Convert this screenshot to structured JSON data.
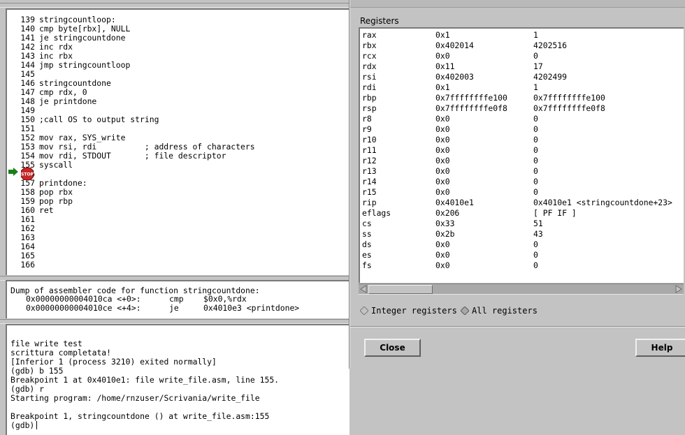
{
  "source": {
    "lines": [
      {
        "num": "139",
        "code": "stringcountloop:"
      },
      {
        "num": "140",
        "code": "cmp byte[rbx], NULL"
      },
      {
        "num": "141",
        "code": "je stringcountdone"
      },
      {
        "num": "142",
        "code": "inc rdx"
      },
      {
        "num": "143",
        "code": "inc rbx"
      },
      {
        "num": "144",
        "code": "jmp stringcountloop"
      },
      {
        "num": "145",
        "code": ""
      },
      {
        "num": "146",
        "code": "stringcountdone"
      },
      {
        "num": "147",
        "code": "cmp rdx, 0"
      },
      {
        "num": "148",
        "code": "je printdone"
      },
      {
        "num": "149",
        "code": ""
      },
      {
        "num": "150",
        "code": ";call OS to output string"
      },
      {
        "num": "151",
        "code": ""
      },
      {
        "num": "152",
        "code": "mov rax, SYS_write"
      },
      {
        "num": "153",
        "code": "mov rsi, rdi          ; address of characters"
      },
      {
        "num": "154",
        "code": "mov rdi, STDOUT       ; file descriptor"
      },
      {
        "num": "155",
        "code": "syscall"
      },
      {
        "num": "156",
        "code": ""
      },
      {
        "num": "157",
        "code": "printdone:"
      },
      {
        "num": "158",
        "code": "pop rbx"
      },
      {
        "num": "159",
        "code": "pop rbp"
      },
      {
        "num": "160",
        "code": "ret"
      },
      {
        "num": "161",
        "code": ""
      },
      {
        "num": "162",
        "code": ""
      },
      {
        "num": "163",
        "code": ""
      },
      {
        "num": "164",
        "code": ""
      },
      {
        "num": "165",
        "code": ""
      },
      {
        "num": "166",
        "code": ""
      }
    ],
    "breakpoint_sign": "STOP",
    "exec_arrow_color": "#1a7f1a",
    "stop_color": "#c62828"
  },
  "assembler": {
    "title": "Dump of assembler code for function stringcountdone:",
    "rows": [
      {
        "addr": "0x00000000004010ca <+0>:",
        "op": "cmp",
        "args": "$0x0,%rdx"
      },
      {
        "addr": "0x00000000004010ce <+4>:",
        "op": "je",
        "args": "0x4010e3 <printdone>"
      }
    ]
  },
  "console": {
    "lines": [
      "file write test",
      "scrittura completata!",
      "[Inferior 1 (process 3210) exited normally]",
      "(gdb) b 155",
      "Breakpoint 1 at 0x4010e1: file write_file.asm, line 155.",
      "(gdb) r",
      "Starting program: /home/rnzuser/Scrivania/write_file",
      "",
      "Breakpoint 1, stringcountdone () at write_file.asm:155"
    ],
    "prompt": "(gdb)"
  },
  "registers_dialog": {
    "label": "Registers",
    "rows": [
      {
        "name": "rax",
        "hex": "0x1",
        "nat": "1"
      },
      {
        "name": "rbx",
        "hex": "0x402014",
        "nat": "4202516"
      },
      {
        "name": "rcx",
        "hex": "0x0",
        "nat": "0"
      },
      {
        "name": "rdx",
        "hex": "0x11",
        "nat": "17"
      },
      {
        "name": "rsi",
        "hex": "0x402003",
        "nat": "4202499"
      },
      {
        "name": "rdi",
        "hex": "0x1",
        "nat": "1"
      },
      {
        "name": "rbp",
        "hex": "0x7ffffffffe100",
        "nat": "0x7ffffffffe100"
      },
      {
        "name": "rsp",
        "hex": "0x7ffffffffe0f8",
        "nat": "0x7ffffffffe0f8"
      },
      {
        "name": "r8",
        "hex": "0x0",
        "nat": "0"
      },
      {
        "name": "r9",
        "hex": "0x0",
        "nat": "0"
      },
      {
        "name": "r10",
        "hex": "0x0",
        "nat": "0"
      },
      {
        "name": "r11",
        "hex": "0x0",
        "nat": "0"
      },
      {
        "name": "r12",
        "hex": "0x0",
        "nat": "0"
      },
      {
        "name": "r13",
        "hex": "0x0",
        "nat": "0"
      },
      {
        "name": "r14",
        "hex": "0x0",
        "nat": "0"
      },
      {
        "name": "r15",
        "hex": "0x0",
        "nat": "0"
      },
      {
        "name": "rip",
        "hex": "0x4010e1",
        "nat": "0x4010e1 <stringcountdone+23>"
      },
      {
        "name": "eflags",
        "hex": "0x206",
        "nat": "[ PF IF ]"
      },
      {
        "name": "cs",
        "hex": "0x33",
        "nat": "51"
      },
      {
        "name": "ss",
        "hex": "0x2b",
        "nat": "43"
      },
      {
        "name": "ds",
        "hex": "0x0",
        "nat": "0"
      },
      {
        "name": "es",
        "hex": "0x0",
        "nat": "0"
      },
      {
        "name": "fs",
        "hex": "0x0",
        "nat": "0"
      }
    ],
    "radio_integer": "Integer registers",
    "radio_all": "All registers",
    "radio_selected": "All registers",
    "close_label": "Close",
    "help_label": "Help"
  }
}
